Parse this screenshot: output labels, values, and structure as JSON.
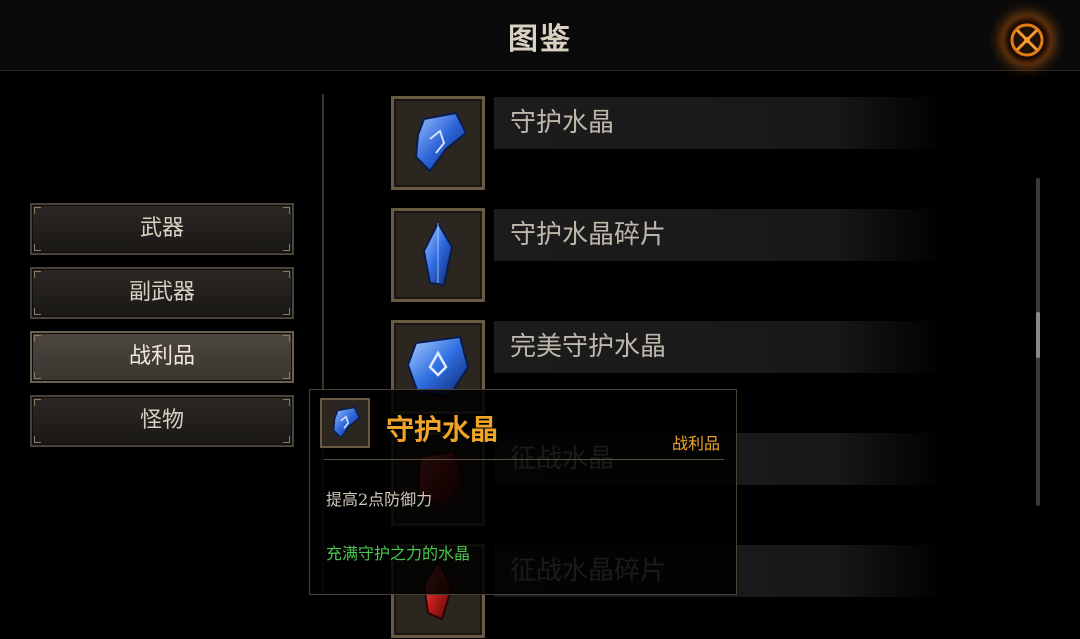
{
  "header": {
    "title": "图鉴",
    "close_icon": "close-crossed-swords-icon"
  },
  "categories": [
    {
      "label": "武器",
      "active": false
    },
    {
      "label": "副武器",
      "active": false
    },
    {
      "label": "战利品",
      "active": true
    },
    {
      "label": "怪物",
      "active": false
    }
  ],
  "items": [
    {
      "name": "守护水晶",
      "icon": "blue-crystal-rune-icon"
    },
    {
      "name": "守护水晶碎片",
      "icon": "blue-crystal-shard-icon"
    },
    {
      "name": "完美守护水晶",
      "icon": "blue-crystal-perfect-icon"
    },
    {
      "name": "征战水晶",
      "icon": "red-crystal-icon"
    },
    {
      "name": "征战水晶碎片",
      "icon": "red-crystal-shard-icon"
    }
  ],
  "tooltip": {
    "name": "守护水晶",
    "category": "战利品",
    "description": "提高2点防御力",
    "flavor": "充满守护之力的水晶",
    "icon": "blue-crystal-rune-icon"
  },
  "colors": {
    "accent": "#f0a428",
    "flavor": "#48c850",
    "close_glow": "#e0801a"
  },
  "scrollbar": {
    "position": 0.41
  }
}
